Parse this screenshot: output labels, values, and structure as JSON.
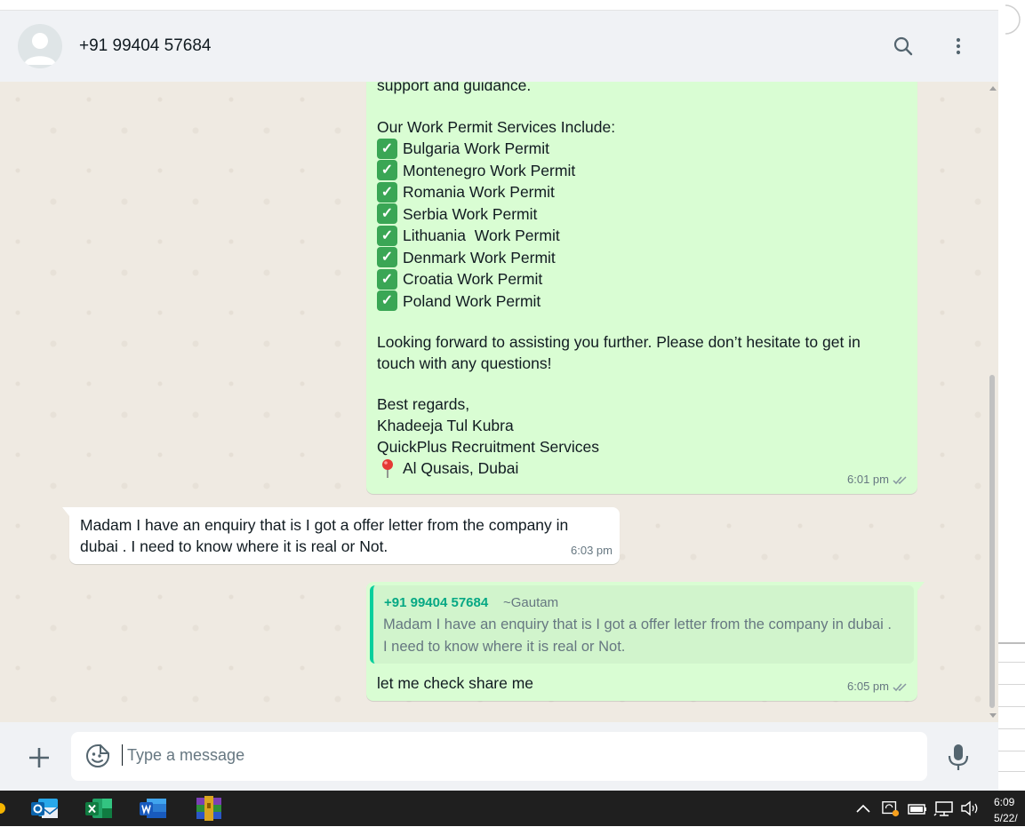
{
  "header": {
    "contact_name": "+91 99404 57684",
    "avatar_icon": "default-avatar-icon",
    "search_icon": "search-icon",
    "menu_icon": "kebab-menu-icon"
  },
  "messages": {
    "m1": {
      "intro_tail": "support and guidance.",
      "services_heading": "Our Work Permit Services Include:",
      "services": [
        "Bulgaria Work Permit",
        "Montenegro Work Permit",
        "Romania Work Permit",
        "Serbia Work Permit",
        "Lithuania  Work Permit",
        "Denmark Work Permit",
        "Croatia Work Permit",
        "Poland Work Permit"
      ],
      "closing_1": "Looking forward to assisting you further. Please don’t hesitate to get in",
      "closing_2": "touch with any questions!",
      "sign_1": "Best regards,",
      "sign_2": "Khadeeja Tul Kubra",
      "sign_3": "QuickPlus Recruitment Services",
      "sign_4": "Al Qusais, Dubai",
      "time": "6:01 pm"
    },
    "m2": {
      "line_1": "Madam I have an enquiry that is I got a offer letter from the company in",
      "line_2": "dubai . I need to know where it is real or Not.",
      "time": "6:03 pm"
    },
    "m3": {
      "quote_name": "+91 99404 57684",
      "quote_pushname": "~Gautam",
      "quote_line_1": "Madam I have an enquiry that is I got a offer letter from the company in dubai .",
      "quote_line_2": "I need to know where it is real or Not.",
      "text": "let me check share me",
      "time": "6:05 pm"
    }
  },
  "compose": {
    "placeholder": "Type a message"
  },
  "taskbar": {
    "time": "6:09",
    "date": "5/22/"
  },
  "colors": {
    "outgoing_bubble": "#d9fdd3",
    "incoming_bubble": "#ffffff",
    "chat_bg": "#efeae2",
    "quote_accent": "#06cf9c",
    "read_ticks": "#8696a0"
  }
}
